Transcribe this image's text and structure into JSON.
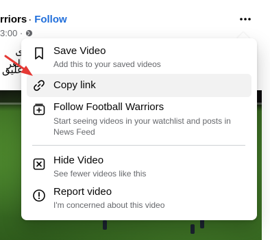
{
  "post": {
    "author_fragment": "rriors",
    "separator": "·",
    "follow_label": "Follow",
    "time_fragment": "3:00 ·",
    "arabic_line_1": "ى العر",
    "arabic_line_2": "علیق"
  },
  "menu": {
    "items": [
      {
        "title": "Save Video",
        "subtitle": "Add this to your saved videos",
        "icon": "bookmark-icon"
      },
      {
        "title": "Copy link",
        "subtitle": "",
        "icon": "link-icon"
      },
      {
        "title": "Follow Football Warriors",
        "subtitle": "Start seeing videos in your watchlist and posts in News Feed",
        "icon": "follow-add-icon"
      },
      {
        "title": "Hide Video",
        "subtitle": "See fewer videos like this",
        "icon": "hide-x-icon"
      },
      {
        "title": "Report video",
        "subtitle": "I'm concerned about this video",
        "icon": "report-alert-icon"
      }
    ]
  },
  "colors": {
    "accent": "#216fdb",
    "hover": "#f2f2f2",
    "annotation_arrow": "#e53935"
  }
}
